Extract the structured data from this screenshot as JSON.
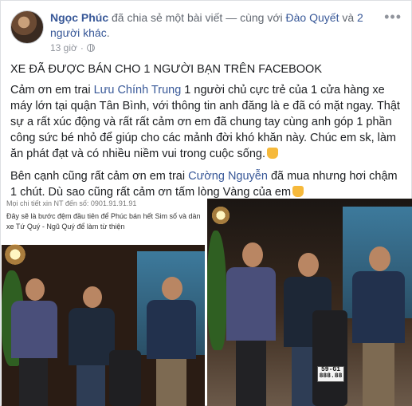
{
  "header": {
    "author": "Ngọc Phúc",
    "action_text": " đã chia sẻ một bài viết — cùng với ",
    "tagged_person": "Đào Quyết",
    "and_text": " và ",
    "others": "2 người khác",
    "end_punct": ".",
    "timestamp": "13 giờ",
    "more_icon": "•••"
  },
  "post": {
    "title": "XE ĐÃ ĐƯỢC BÁN CHO 1 NGƯỜI BẠN TRÊN FACEBOOK",
    "p1_before": "Cảm ơn em trai ",
    "p1_name": "Lưu Chính Trung",
    "p1_after": " 1 người chủ cực trẻ của 1 cửa hàng xe máy lớn tại quận Tân Bình, với thông tin anh đăng là e đã có mặt ngay. Thật sự a rất xúc động và rất rất cảm ơn em đã chung tay cùng anh góp 1 phần công sức bé nhỏ để giúp cho các mảnh đời khó khăn này. Chúc em sk, làm ăn phát đạt và có nhiều niềm vui trong cuộc sống.",
    "p2_before": "Bên cạnh cũng rất cảm ơn em trai ",
    "p2_name": "Cường Nguyễn",
    "p2_after": " đã mua nhưng hơi chậm 1 chút. Dù sao cũng rất cảm ơn tấm lòng Vàng của em"
  },
  "photos": {
    "left_caption_1": "Mọi chi tiết xin NT đến số: 0901.91.91.91",
    "left_caption_2": "Đây sẽ là bước đệm đầu tiên để Phúc bán hết Sim số và dàn",
    "left_caption_3": "xe Tứ Quý - Ngũ Quý để làm từ thiện",
    "plate_line_1": "59-G1",
    "plate_line_2": "888.88"
  },
  "colors": {
    "link": "#385898",
    "meta": "#90949c",
    "text": "#1c1e21"
  },
  "icons": [
    "more-options-icon",
    "globe-icon",
    "thumbs-up-emoji"
  ]
}
